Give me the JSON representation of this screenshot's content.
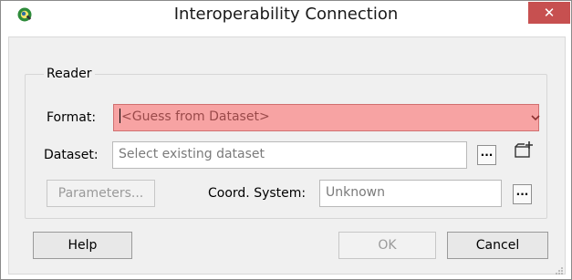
{
  "window": {
    "title": "Interoperability Connection",
    "close_glyph": "✕",
    "accent_close": "#c75050"
  },
  "reader": {
    "group_label": "Reader",
    "format_label": "Format:",
    "format_value": "<Guess from Dataset>",
    "dataset_label": "Dataset:",
    "dataset_placeholder": "Select existing dataset",
    "browse_label": "...",
    "parameters_label": "Parameters...",
    "coord_label": "Coord. System:",
    "coord_value": "Unknown",
    "coord_browse_label": "..."
  },
  "footer": {
    "help_label": "Help",
    "ok_label": "OK",
    "cancel_label": "Cancel"
  },
  "colors": {
    "format_invalid_bg": "#f7a3a3",
    "client_bg": "#f0f0f0"
  },
  "icons": {
    "app": "qgis-logo-icon",
    "add": "add-connection-icon",
    "dropdown": "chevron-down-icon",
    "resize": "resize-grip-icon"
  }
}
